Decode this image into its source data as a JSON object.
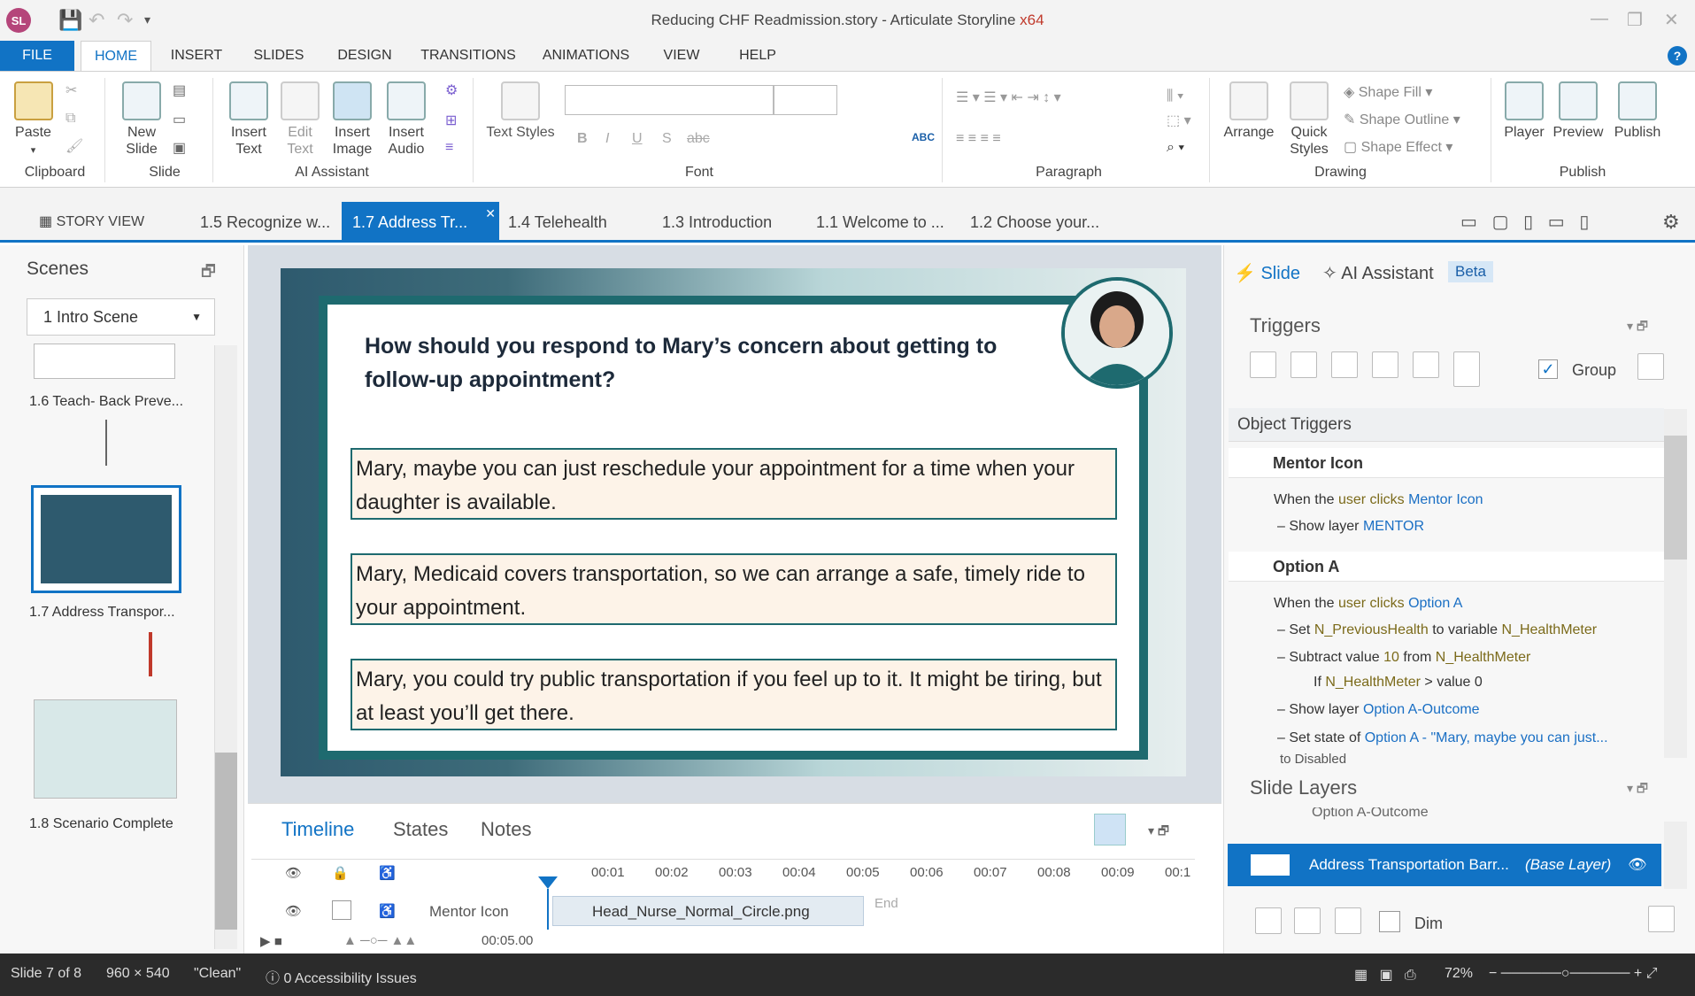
{
  "window": {
    "title": "Reducing CHF Readmission.story",
    "app": " -  Articulate Storyline ",
    "arch": "x64",
    "logo": "SL"
  },
  "menu": [
    "FILE",
    "HOME",
    "INSERT",
    "SLIDES",
    "DESIGN",
    "TRANSITIONS",
    "ANIMATIONS",
    "VIEW",
    "HELP"
  ],
  "ribbon": {
    "paste": "Paste",
    "new_slide": "New Slide",
    "insert_text": "Insert Text",
    "edit_text": "Edit Text",
    "insert_image": "Insert Image",
    "insert_audio": "Insert Audio",
    "text_styles": "Text Styles",
    "arrange": "Arrange",
    "quick_styles": "Quick Styles",
    "shape_fill": "Shape Fill",
    "shape_outline": "Shape Outline",
    "shape_effect": "Shape Effect",
    "player": "Player",
    "preview": "Preview",
    "publish": "Publish",
    "groups": {
      "clipboard": "Clipboard",
      "slide": "Slide",
      "ai": "AI Assistant",
      "font": "Font",
      "paragraph": "Paragraph",
      "drawing": "Drawing",
      "publish": "Publish"
    }
  },
  "story_tabs": {
    "story_view": "STORY VIEW",
    "tabs": [
      "1.5 Recognize w...",
      "1.7 Address Tr...",
      "1.4 Telehealth",
      "1.3 Introduction",
      "1.1 Welcome to ...",
      "1.2 Choose your..."
    ]
  },
  "scenes": {
    "title": "Scenes",
    "selected_scene": "1 Intro Scene",
    "slides": [
      "1.6 Teach- Back Preve...",
      "1.7 Address Transpor...",
      "1.8 Scenario Complete"
    ]
  },
  "slide": {
    "question": "How should you respond to Mary’s concern about getting to follow-up appointment?",
    "options": [
      "Mary, maybe you can just reschedule your appointment for a time when your daughter is available.",
      "Mary, Medicaid covers transportation, so we can arrange a safe, timely ride to your appointment.",
      "Mary, you could try public transportation if you feel up to it. It might be tiring, but at least you’ll get there."
    ]
  },
  "timeline": {
    "tabs": [
      "Timeline",
      "States",
      "Notes"
    ],
    "ticks": [
      "00:01",
      "00:02",
      "00:03",
      "00:04",
      "00:05",
      "00:06",
      "00:07",
      "00:08",
      "00:09",
      "00:1"
    ],
    "row_name": "Mentor Icon",
    "row_file": "Head_Nurse_Normal_Circle.png",
    "end": "End",
    "time": "00:05.00"
  },
  "right_panel": {
    "tab_slide": "Slide",
    "tab_ai": "AI Assistant",
    "beta": "Beta",
    "triggers_title": "Triggers",
    "group_label": "Group",
    "object_triggers": "Object Triggers",
    "mentor_head": "Mentor Icon",
    "mentor_when": "When the",
    "mentor_user": "user clicks",
    "mentor_obj": "Mentor Icon",
    "mentor_action": "Show layer",
    "mentor_layer": "MENTOR",
    "option_head": "Option A",
    "opt_when": "When the",
    "opt_user": "user clicks",
    "opt_obj": "Option A",
    "opt_set": "Set",
    "opt_var1": "N_PreviousHealth",
    "opt_to": "to variable",
    "opt_var2": "N_HealthMeter",
    "opt_sub": "Subtract value",
    "opt_val": "10",
    "opt_from": "from",
    "opt_var3": "N_HealthMeter",
    "opt_if": "If",
    "opt_var4": "N_HealthMeter",
    "opt_cond": "> value 0",
    "opt_show": "Show layer",
    "opt_layer": "Option A-Outcome",
    "opt_state": "Set state of",
    "opt_state_obj": "Option A - \"Mary, maybe you can just...",
    "opt_state_to": "to Disabled",
    "layers_title": "Slide Layers",
    "layer_partial": "Option A-Outcome",
    "base_layer": "Address Transportation Barr...",
    "base_tag": "(Base Layer)",
    "dim": "Dim"
  },
  "status": {
    "slide": "Slide 7 of 8",
    "size": "960 × 540",
    "theme": "\"Clean\"",
    "accessibility": "0 Accessibility Issues",
    "zoom": "72%"
  }
}
